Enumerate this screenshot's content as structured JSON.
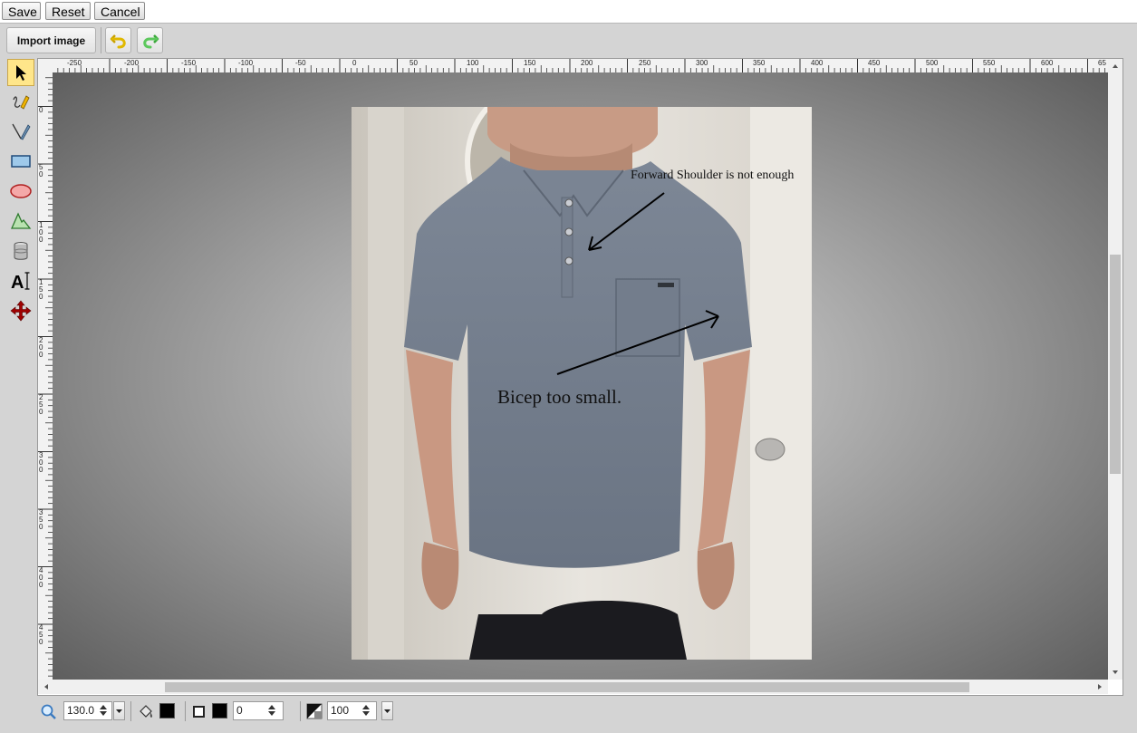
{
  "topbar": {
    "save_label": "Save",
    "reset_label": "Reset",
    "cancel_label": "Cancel"
  },
  "toolbar": {
    "import_label": "Import image",
    "undo_icon": "undo-icon",
    "redo_icon": "redo-icon"
  },
  "tools": [
    "select-tool",
    "freehand-tool",
    "pen-tool",
    "rectangle-tool",
    "ellipse-tool",
    "polygon-tool",
    "shape-library-tool",
    "text-tool",
    "move-tool"
  ],
  "ruler": {
    "top_labels": [
      "-250",
      "-200",
      "-150",
      "-100",
      "-50",
      "0",
      "50",
      "100",
      "150",
      "200",
      "250",
      "300",
      "350",
      "400",
      "450",
      "500",
      "550",
      "600",
      "65"
    ],
    "left_labels": [
      "0",
      "5 0",
      "1 0 0",
      "1 5 0",
      "2 0 0",
      "2 5 0",
      "3 0 0",
      "3 5 0",
      "4 0 0",
      "4 5 0"
    ]
  },
  "annotations": {
    "shoulder_text": "Forward Shoulder is not enough",
    "bicep_text": "Bicep too small."
  },
  "bottom": {
    "zoom_value": "130.0",
    "stroke_width": "0",
    "opacity": "100"
  },
  "colors": {
    "fill": "#000000",
    "stroke": "#000000",
    "selected_tool_bg": "#ffe68a"
  }
}
